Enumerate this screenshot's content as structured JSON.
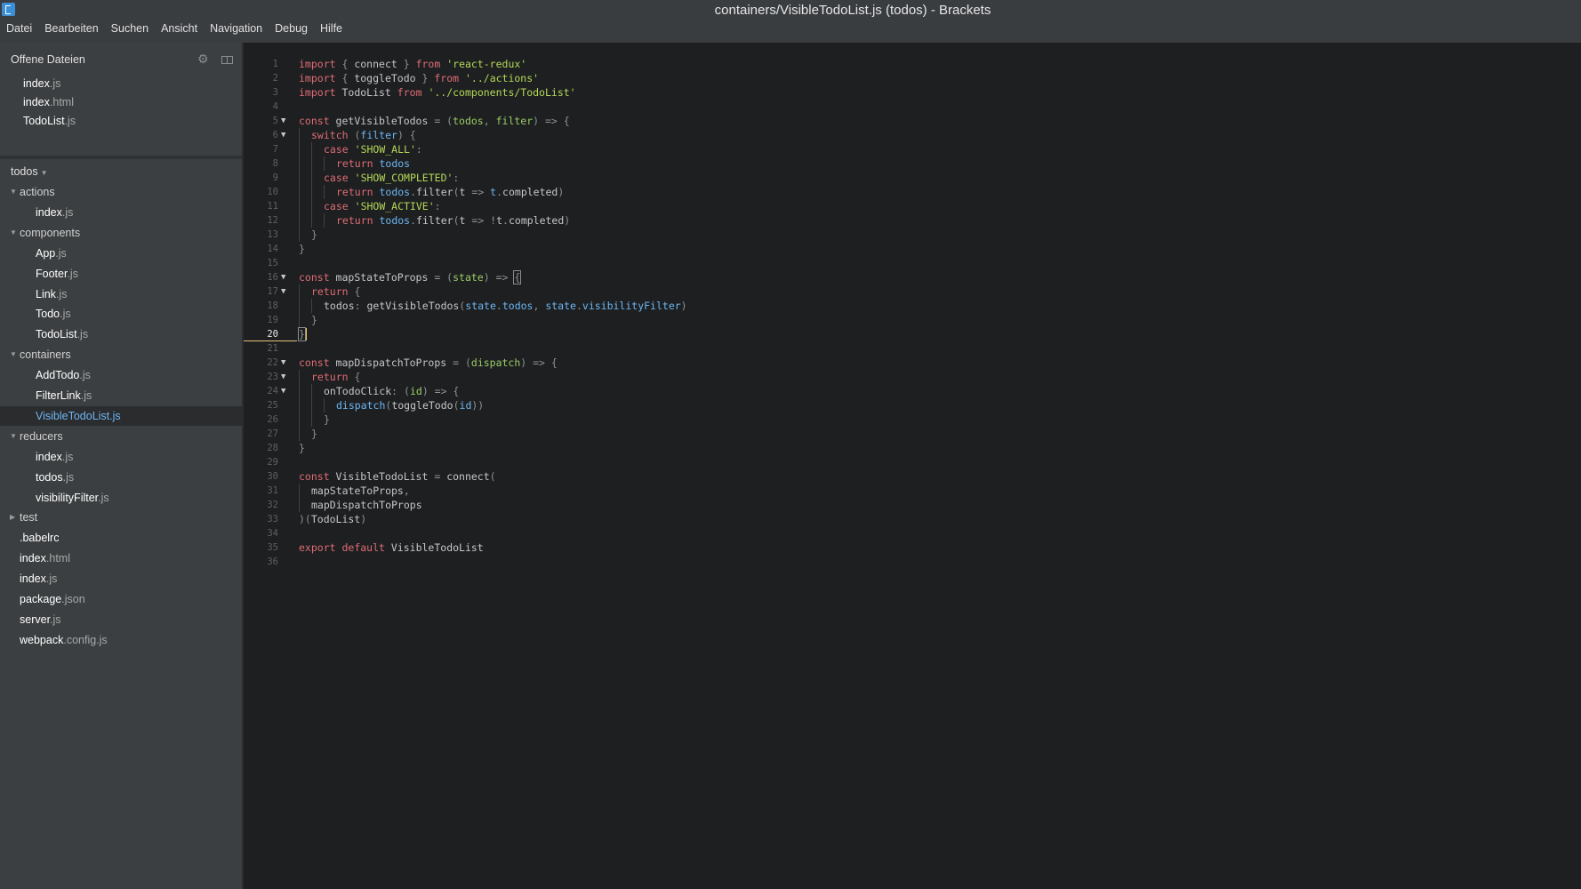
{
  "window": {
    "title": "containers/VisibleTodoList.js (todos) - Brackets"
  },
  "menubar": [
    "Datei",
    "Bearbeiten",
    "Suchen",
    "Ansicht",
    "Navigation",
    "Debug",
    "Hilfe"
  ],
  "sidebar": {
    "working_set_title": "Offene Dateien",
    "working_set": [
      {
        "name": "index",
        "ext": ".js"
      },
      {
        "name": "index",
        "ext": ".html"
      },
      {
        "name": "TodoList",
        "ext": ".js"
      }
    ],
    "project_name": "todos",
    "tree": [
      {
        "type": "folder",
        "open": true,
        "label": "actions",
        "depth": 0
      },
      {
        "type": "file",
        "name": "index",
        "ext": ".js",
        "depth": 1
      },
      {
        "type": "folder",
        "open": true,
        "label": "components",
        "depth": 0
      },
      {
        "type": "file",
        "name": "App",
        "ext": ".js",
        "depth": 1
      },
      {
        "type": "file",
        "name": "Footer",
        "ext": ".js",
        "depth": 1
      },
      {
        "type": "file",
        "name": "Link",
        "ext": ".js",
        "depth": 1
      },
      {
        "type": "file",
        "name": "Todo",
        "ext": ".js",
        "depth": 1
      },
      {
        "type": "file",
        "name": "TodoList",
        "ext": ".js",
        "depth": 1
      },
      {
        "type": "folder",
        "open": true,
        "label": "containers",
        "depth": 0
      },
      {
        "type": "file",
        "name": "AddTodo",
        "ext": ".js",
        "depth": 1
      },
      {
        "type": "file",
        "name": "FilterLink",
        "ext": ".js",
        "depth": 1
      },
      {
        "type": "file",
        "name": "VisibleTodoList",
        "ext": ".js",
        "depth": 1,
        "selected": true
      },
      {
        "type": "folder",
        "open": true,
        "label": "reducers",
        "depth": 0
      },
      {
        "type": "file",
        "name": "index",
        "ext": ".js",
        "depth": 1
      },
      {
        "type": "file",
        "name": "todos",
        "ext": ".js",
        "depth": 1
      },
      {
        "type": "file",
        "name": "visibilityFilter",
        "ext": ".js",
        "depth": 1
      },
      {
        "type": "folder",
        "open": false,
        "label": "test",
        "depth": 0
      },
      {
        "type": "file",
        "name": ".babelrc",
        "ext": "",
        "depth": 0
      },
      {
        "type": "file",
        "name": "index",
        "ext": ".html",
        "depth": 0
      },
      {
        "type": "file",
        "name": "index",
        "ext": ".js",
        "depth": 0
      },
      {
        "type": "file",
        "name": "package",
        "ext": ".json",
        "depth": 0
      },
      {
        "type": "file",
        "name": "server",
        "ext": ".js",
        "depth": 0
      },
      {
        "type": "file",
        "name": "webpack",
        "ext": ".config.js",
        "depth": 0
      }
    ]
  },
  "editor": {
    "active_line": 20,
    "lines": [
      {
        "n": "1",
        "fold": "",
        "g": 0,
        "t": [
          [
            "kw",
            "import"
          ],
          [
            "pu",
            " { "
          ],
          [
            "pl",
            "connect"
          ],
          [
            "pu",
            " } "
          ],
          [
            "kw",
            "from"
          ],
          [
            "pl",
            " "
          ],
          [
            "str",
            "'react-redux'"
          ]
        ]
      },
      {
        "n": "2",
        "fold": "",
        "g": 0,
        "t": [
          [
            "kw",
            "import"
          ],
          [
            "pu",
            " { "
          ],
          [
            "pl",
            "toggleTodo"
          ],
          [
            "pu",
            " } "
          ],
          [
            "kw",
            "from"
          ],
          [
            "pl",
            " "
          ],
          [
            "str",
            "'../actions'"
          ]
        ]
      },
      {
        "n": "3",
        "fold": "",
        "g": 0,
        "t": [
          [
            "kw",
            "import"
          ],
          [
            "pl",
            " TodoList "
          ],
          [
            "kw",
            "from"
          ],
          [
            "pl",
            " "
          ],
          [
            "str",
            "'../components/TodoList'"
          ]
        ]
      },
      {
        "n": "4",
        "fold": "",
        "g": 0,
        "t": []
      },
      {
        "n": "5",
        "fold": "▼",
        "g": 0,
        "t": [
          [
            "kw",
            "const"
          ],
          [
            "pl",
            " getVisibleTodos "
          ],
          [
            "pu",
            "= ("
          ],
          [
            "par",
            "todos"
          ],
          [
            "pu",
            ", "
          ],
          [
            "par",
            "filter"
          ],
          [
            "pu",
            ") => {"
          ]
        ]
      },
      {
        "n": "6",
        "fold": "▼",
        "g": 1,
        "t": [
          [
            "kw",
            "switch"
          ],
          [
            "pu",
            " ("
          ],
          [
            "fn",
            "filter"
          ],
          [
            "pu",
            ") {"
          ]
        ]
      },
      {
        "n": "7",
        "fold": "",
        "g": 2,
        "t": [
          [
            "kw",
            "case"
          ],
          [
            "pl",
            " "
          ],
          [
            "str",
            "'SHOW_ALL'"
          ],
          [
            "pu",
            ":"
          ]
        ]
      },
      {
        "n": "8",
        "fold": "",
        "g": 3,
        "t": [
          [
            "kw",
            "return"
          ],
          [
            "pl",
            " "
          ],
          [
            "fn",
            "todos"
          ]
        ]
      },
      {
        "n": "9",
        "fold": "",
        "g": 2,
        "t": [
          [
            "kw",
            "case"
          ],
          [
            "pl",
            " "
          ],
          [
            "str",
            "'SHOW_COMPLETED'"
          ],
          [
            "pu",
            ":"
          ]
        ]
      },
      {
        "n": "10",
        "fold": "",
        "g": 3,
        "t": [
          [
            "kw",
            "return"
          ],
          [
            "pl",
            " "
          ],
          [
            "fn",
            "todos"
          ],
          [
            "pu",
            "."
          ],
          [
            "pl",
            "filter"
          ],
          [
            "pu",
            "("
          ],
          [
            "pl",
            "t"
          ],
          [
            "pu",
            " => "
          ],
          [
            "fn",
            "t"
          ],
          [
            "pu",
            "."
          ],
          [
            "pl",
            "completed"
          ],
          [
            "pu",
            ")"
          ]
        ]
      },
      {
        "n": "11",
        "fold": "",
        "g": 2,
        "t": [
          [
            "kw",
            "case"
          ],
          [
            "pl",
            " "
          ],
          [
            "str",
            "'SHOW_ACTIVE'"
          ],
          [
            "pu",
            ":"
          ]
        ]
      },
      {
        "n": "12",
        "fold": "",
        "g": 3,
        "t": [
          [
            "kw",
            "return"
          ],
          [
            "pl",
            " "
          ],
          [
            "fn",
            "todos"
          ],
          [
            "pu",
            "."
          ],
          [
            "pl",
            "filter"
          ],
          [
            "pu",
            "("
          ],
          [
            "pl",
            "t"
          ],
          [
            "pu",
            " => !"
          ],
          [
            "pl",
            "t"
          ],
          [
            "pu",
            "."
          ],
          [
            "pl",
            "completed"
          ],
          [
            "pu",
            ")"
          ]
        ]
      },
      {
        "n": "13",
        "fold": "",
        "g": 1,
        "t": [
          [
            "pu",
            "}"
          ]
        ]
      },
      {
        "n": "14",
        "fold": "",
        "g": 0,
        "t": [
          [
            "pu",
            "}"
          ]
        ]
      },
      {
        "n": "15",
        "fold": "",
        "g": 0,
        "t": []
      },
      {
        "n": "16",
        "fold": "▼",
        "g": 0,
        "t": [
          [
            "kw",
            "const"
          ],
          [
            "pl",
            " mapStateToProps "
          ],
          [
            "pu",
            "= ("
          ],
          [
            "par",
            "state"
          ],
          [
            "pu",
            ") => "
          ],
          [
            "bracket",
            "{"
          ]
        ]
      },
      {
        "n": "17",
        "fold": "▼",
        "g": 1,
        "t": [
          [
            "kw",
            "return"
          ],
          [
            "pu",
            " {"
          ]
        ]
      },
      {
        "n": "18",
        "fold": "",
        "g": 2,
        "t": [
          [
            "pl",
            "todos"
          ],
          [
            "pu",
            ": "
          ],
          [
            "pl",
            "getVisibleTodos"
          ],
          [
            "pu",
            "("
          ],
          [
            "fn",
            "state"
          ],
          [
            "pu",
            "."
          ],
          [
            "fn",
            "todos"
          ],
          [
            "pu",
            ", "
          ],
          [
            "fn",
            "state"
          ],
          [
            "pu",
            "."
          ],
          [
            "fn",
            "visibilityFilter"
          ],
          [
            "pu",
            ")"
          ]
        ]
      },
      {
        "n": "19",
        "fold": "",
        "g": 1,
        "t": [
          [
            "pu",
            "}"
          ]
        ]
      },
      {
        "n": "20",
        "fold": "",
        "g": 0,
        "t": [
          [
            "bracketcursor",
            "}"
          ]
        ]
      },
      {
        "n": "21",
        "fold": "",
        "g": 0,
        "t": []
      },
      {
        "n": "22",
        "fold": "▼",
        "g": 0,
        "t": [
          [
            "kw",
            "const"
          ],
          [
            "pl",
            " mapDispatchToProps "
          ],
          [
            "pu",
            "= ("
          ],
          [
            "par",
            "dispatch"
          ],
          [
            "pu",
            ") => {"
          ]
        ]
      },
      {
        "n": "23",
        "fold": "▼",
        "g": 1,
        "t": [
          [
            "kw",
            "return"
          ],
          [
            "pu",
            " {"
          ]
        ]
      },
      {
        "n": "24",
        "fold": "▼",
        "g": 2,
        "t": [
          [
            "pl",
            "onTodoClick"
          ],
          [
            "pu",
            ": ("
          ],
          [
            "par",
            "id"
          ],
          [
            "pu",
            ") => {"
          ]
        ]
      },
      {
        "n": "25",
        "fold": "",
        "g": 3,
        "t": [
          [
            "fn",
            "dispatch"
          ],
          [
            "pu",
            "("
          ],
          [
            "pl",
            "toggleTodo"
          ],
          [
            "pu",
            "("
          ],
          [
            "fn",
            "id"
          ],
          [
            "pu",
            "))"
          ]
        ]
      },
      {
        "n": "26",
        "fold": "",
        "g": 2,
        "t": [
          [
            "pu",
            "}"
          ]
        ]
      },
      {
        "n": "27",
        "fold": "",
        "g": 1,
        "t": [
          [
            "pu",
            "}"
          ]
        ]
      },
      {
        "n": "28",
        "fold": "",
        "g": 0,
        "t": [
          [
            "pu",
            "}"
          ]
        ]
      },
      {
        "n": "29",
        "fold": "",
        "g": 0,
        "t": []
      },
      {
        "n": "30",
        "fold": "",
        "g": 0,
        "t": [
          [
            "kw",
            "const"
          ],
          [
            "pl",
            " VisibleTodoList "
          ],
          [
            "pu",
            "= "
          ],
          [
            "pl",
            "connect"
          ],
          [
            "pu",
            "("
          ]
        ]
      },
      {
        "n": "31",
        "fold": "",
        "g": 1,
        "t": [
          [
            "pl",
            "mapStateToProps"
          ],
          [
            "pu",
            ","
          ]
        ]
      },
      {
        "n": "32",
        "fold": "",
        "g": 1,
        "t": [
          [
            "pl",
            "mapDispatchToProps"
          ]
        ]
      },
      {
        "n": "33",
        "fold": "",
        "g": 0,
        "t": [
          [
            "pu",
            ")("
          ],
          [
            "pl",
            "TodoList"
          ],
          [
            "pu",
            ")"
          ]
        ]
      },
      {
        "n": "34",
        "fold": "",
        "g": 0,
        "t": []
      },
      {
        "n": "35",
        "fold": "",
        "g": 0,
        "t": [
          [
            "kw",
            "export"
          ],
          [
            "pl",
            " "
          ],
          [
            "kw",
            "default"
          ],
          [
            "pl",
            " VisibleTodoList"
          ]
        ]
      },
      {
        "n": "36",
        "fold": "",
        "g": 0,
        "t": []
      }
    ]
  }
}
